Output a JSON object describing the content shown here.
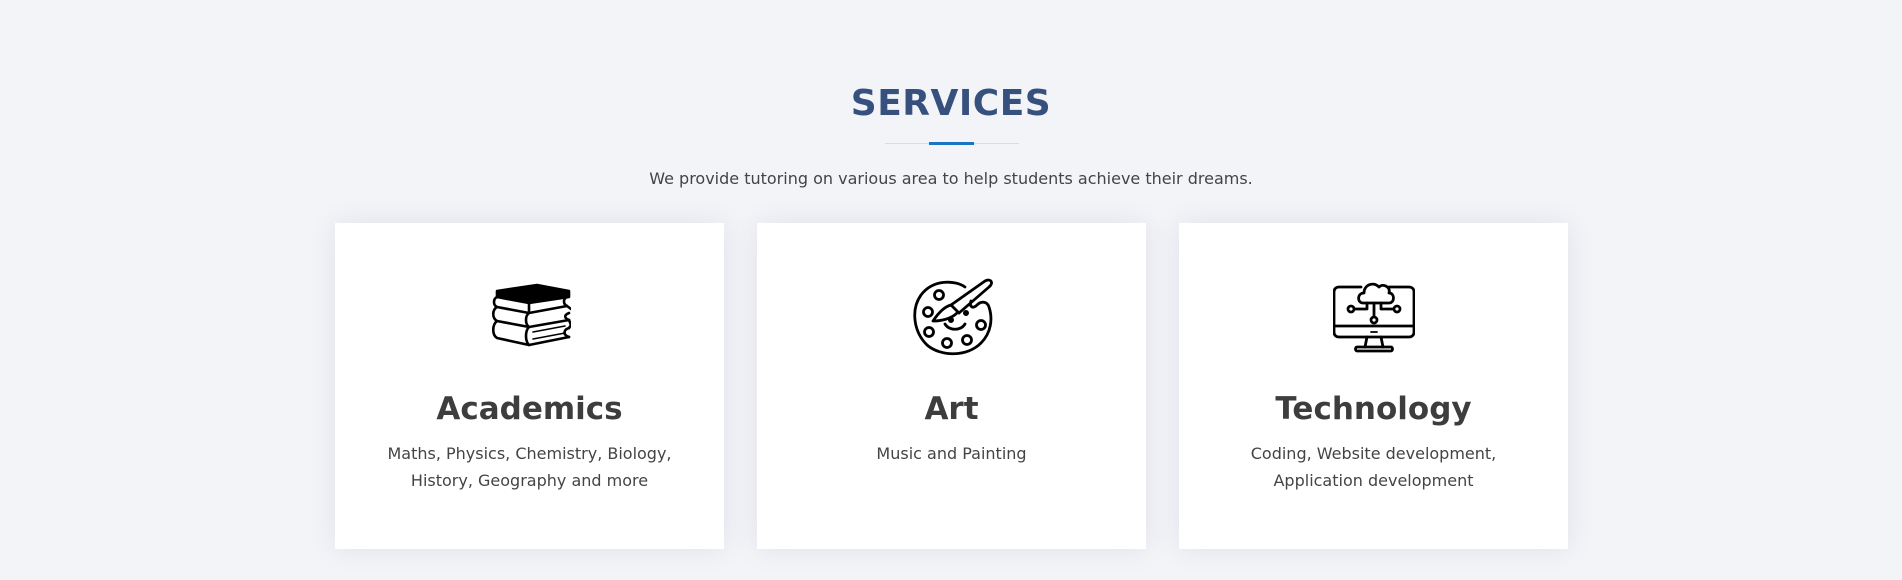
{
  "section": {
    "title": "SERVICES",
    "subtitle": "We provide tutoring on various area to help students achieve their dreams."
  },
  "colors": {
    "title": "#37517e",
    "accent_line": "#1a73c4",
    "background": "#f3f4f8",
    "card": "#ffffff"
  },
  "services": [
    {
      "icon": "books-icon",
      "title": "Academics",
      "description": "Maths, Physics, Chemistry, Biology, History, Geography and more"
    },
    {
      "icon": "paint-palette-icon",
      "title": "Art",
      "description": "Music and Painting"
    },
    {
      "icon": "cloud-computer-icon",
      "title": "Technology",
      "description": "Coding, Website development, Application development"
    }
  ]
}
